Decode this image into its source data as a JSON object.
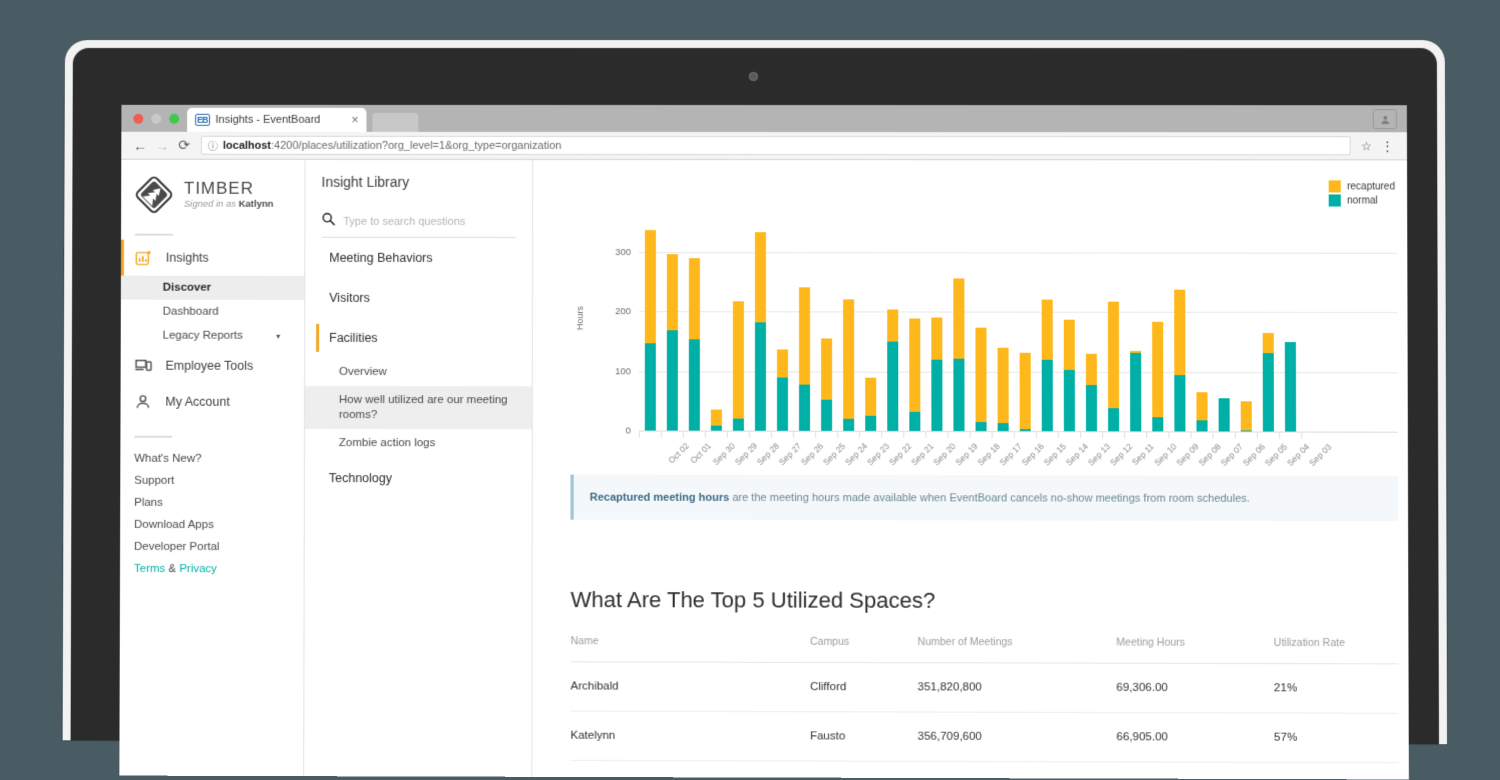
{
  "browser": {
    "tab_title": "Insights - EventBoard",
    "favicon_text": "EB",
    "tab_close": "×",
    "back_icon": "←",
    "forward_icon": "→",
    "reload_icon": "⟳",
    "site_info_icon": "ⓘ",
    "url_host": "localhost",
    "url_rest": ":4200/places/utilization?org_level=1&org_type=organization",
    "star_icon": "☆",
    "menu_icon": "⋮"
  },
  "sidebar": {
    "brand_name": "TIMBER",
    "signed_in_prefix": "Signed in as ",
    "signed_in_user": "Katlynn",
    "primary": [
      {
        "label": "Insights",
        "icon": "insights-icon",
        "active": true
      },
      {
        "label": "Employee Tools",
        "icon": "devices-icon",
        "active": false
      },
      {
        "label": "My Account",
        "icon": "person-icon",
        "active": false
      }
    ],
    "insights_children": [
      {
        "label": "Discover",
        "selected": true,
        "caret": false
      },
      {
        "label": "Dashboard",
        "selected": false,
        "caret": false
      },
      {
        "label": "Legacy Reports",
        "selected": false,
        "caret": true
      }
    ],
    "caret_glyph": "▾",
    "links": [
      "What's New?",
      "Support",
      "Plans",
      "Download Apps",
      "Developer Portal"
    ],
    "legal": {
      "terms": "Terms",
      "amp": " & ",
      "privacy": "Privacy"
    }
  },
  "library": {
    "title": "Insight Library",
    "search_placeholder": "Type to search questions",
    "search_value": "",
    "search_icon": "search-icon",
    "categories": [
      {
        "label": "Meeting Behaviors",
        "active": false,
        "items": []
      },
      {
        "label": "Visitors",
        "active": false,
        "items": []
      },
      {
        "label": "Facilities",
        "active": true,
        "items": [
          {
            "label": "Overview",
            "selected": false
          },
          {
            "label": "How well utilized are our meeting rooms?",
            "selected": true
          },
          {
            "label": "Zombie action logs",
            "selected": false
          }
        ]
      },
      {
        "label": "Technology",
        "active": false,
        "items": []
      }
    ]
  },
  "note": {
    "bold": "Recaptured meeting hours",
    "rest": " are the meeting hours made available when EventBoard cancels no-show meetings from room schedules."
  },
  "table": {
    "title": "What Are The Top 5 Utilized Spaces?",
    "columns": [
      "Name",
      "Campus",
      "Number of Meetings",
      "Meeting Hours",
      "Utilization Rate"
    ],
    "rows": [
      {
        "name": "Archibald",
        "campus": "Clifford",
        "meetings": "351,820,800",
        "hours": "69,306.00",
        "rate": "21%"
      },
      {
        "name": "Katelynn",
        "campus": "Fausto",
        "meetings": "356,709,600",
        "hours": "66,905.00",
        "rate": "57%"
      }
    ]
  },
  "chart_data": {
    "type": "bar",
    "stacked": true,
    "title": "",
    "xlabel": "",
    "ylabel": "Hours",
    "ylim": [
      0,
      340
    ],
    "yticks": [
      0,
      100,
      200,
      300
    ],
    "grid": true,
    "legend_position": "top-right",
    "colors": {
      "recaptured": "#ffb81c",
      "normal": "#00b0a6"
    },
    "categories": [
      "Oct 02",
      "Oct 01",
      "Sep 30",
      "Sep 29",
      "Sep 28",
      "Sep 27",
      "Sep 26",
      "Sep 25",
      "Sep 24",
      "Sep 23",
      "Sep 22",
      "Sep 21",
      "Sep 20",
      "Sep 19",
      "Sep 18",
      "Sep 17",
      "Sep 16",
      "Sep 15",
      "Sep 14",
      "Sep 13",
      "Sep 12",
      "Sep 11",
      "Sep 10",
      "Sep 09",
      "Sep 08",
      "Sep 07",
      "Sep 06",
      "Sep 05",
      "Sep 04",
      "Sep 03"
    ],
    "series": [
      {
        "name": "normal",
        "values": [
          146,
          168,
          154,
          8,
          21,
          181,
          89,
          77,
          52,
          20,
          26,
          150,
          32,
          120,
          121,
          15,
          13,
          3,
          120,
          103,
          78,
          39,
          131,
          24,
          95,
          18,
          55,
          2,
          131,
          150
        ]
      },
      {
        "name": "recaptured",
        "values": [
          190,
          128,
          136,
          27,
          196,
          152,
          47,
          163,
          103,
          200,
          64,
          54,
          156,
          70,
          135,
          159,
          127,
          128,
          101,
          84,
          51,
          178,
          4,
          159,
          143,
          48,
          0,
          48,
          34,
          0
        ]
      }
    ],
    "totals": [
      336,
      296,
      290,
      35,
      217,
      333,
      136,
      240,
      155,
      220,
      90,
      204,
      188,
      190,
      256,
      174,
      140,
      131,
      221,
      187,
      129,
      217,
      135,
      183,
      238,
      66,
      55,
      50,
      165,
      150
    ]
  }
}
